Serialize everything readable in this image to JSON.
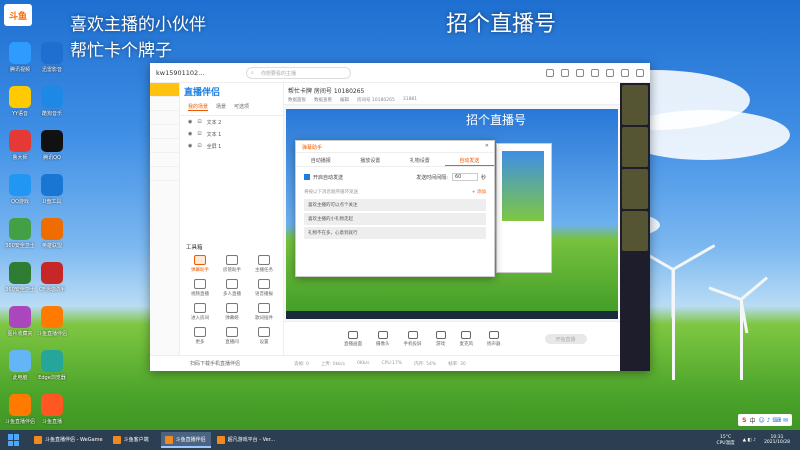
{
  "overlay": {
    "line1": "喜欢主播的小伙伴",
    "line2": "帮忙卡个牌子",
    "stream_title": "招个直播号",
    "douyu_logo": "斗鱼"
  },
  "desktop_icons": [
    {
      "label": "腾讯视频",
      "icon": "video-icon",
      "color": "#2f9bff"
    },
    {
      "label": "迅雷影音",
      "icon": "player-icon",
      "color": "#1e6fd0"
    },
    {
      "label": "YY语音",
      "icon": "yy-icon",
      "color": "#ffcb00"
    },
    {
      "label": "酷狗音乐",
      "icon": "kugou-icon",
      "color": "#1e88e5"
    },
    {
      "label": "鲁大师",
      "icon": "ludashi-icon",
      "color": "#e53935"
    },
    {
      "label": "腾讯QQ",
      "icon": "qq-icon",
      "color": "#111111"
    },
    {
      "label": "QQ游戏",
      "icon": "qqgame-icon",
      "color": "#2196f3"
    },
    {
      "label": "U盘工具",
      "icon": "usb-icon",
      "color": "#1976d2"
    },
    {
      "label": "360安全卫士",
      "icon": "shield-icon",
      "color": "#43a047"
    },
    {
      "label": "英雄联盟",
      "icon": "game-icon",
      "color": "#ef6c00"
    },
    {
      "label": "360安全卫士",
      "icon": "plus-icon",
      "color": "#2e7d32"
    },
    {
      "label": "CF活动助手",
      "icon": "cf-icon",
      "color": "#c62828"
    },
    {
      "label": "图片收藏夹",
      "icon": "photo-icon",
      "color": "#ab47bc"
    },
    {
      "label": "斗鱼直播伴侣",
      "icon": "douyu-icon",
      "color": "#ff7a00"
    },
    {
      "label": "此电脑",
      "icon": "computer-icon",
      "color": "#64b5f6"
    },
    {
      "label": "Edge浏览器",
      "icon": "browser-icon",
      "color": "#26a69a"
    },
    {
      "label": "斗鱼直播伴侣",
      "icon": "douyu-icon",
      "color": "#ff7a00"
    },
    {
      "label": "斗鱼直播",
      "icon": "douyu-icon",
      "color": "#ff5722"
    }
  ],
  "window": {
    "account": "kw15901102...",
    "search_placeholder": "你想要看的主播",
    "logo": "直播伴侣",
    "panel_tabs": [
      "我的场景",
      "场景",
      "可选项"
    ],
    "scenes": [
      "文本 2",
      "文本 1",
      "全屏 1"
    ],
    "tools_title": "工具箱",
    "tools": [
      {
        "label": "弹幕助手",
        "active": true
      },
      {
        "label": "房管助手",
        "active": false
      },
      {
        "label": "主播任务",
        "active": false
      },
      {
        "label": "视频直播",
        "active": false
      },
      {
        "label": "多人直播",
        "active": false
      },
      {
        "label": "语音播报",
        "active": false
      },
      {
        "label": "进入房间",
        "active": false
      },
      {
        "label": "弹幕姬",
        "active": false
      },
      {
        "label": "歌词插件",
        "active": false
      },
      {
        "label": "更多",
        "active": false
      },
      {
        "label": "直播间",
        "active": false
      },
      {
        "label": "设置",
        "active": false
      }
    ],
    "room_title": "帮忙卡牌 房间号 10180265",
    "room_meta": [
      "数据面板",
      "数据查看",
      "编辑",
      "房间号 10180265",
      "31881"
    ],
    "preview_title": "招个直播号",
    "controls": [
      "直播画面",
      "摄像头",
      "手机投屏",
      "游戏",
      "麦克风",
      "扬声器"
    ],
    "start_button": "开始直播",
    "status": [
      "丢帧: 0",
      "上传: 0kb/s",
      "0Kb/s",
      "CPU:17%",
      "内存: 54%",
      "帧率: 30"
    ],
    "bottom_hint": "扫码下载手机直播伴侣"
  },
  "dialog": {
    "title": "弹幕助手",
    "tabs": [
      "自动播报",
      "播放设置",
      "礼物设置",
      "自动发送"
    ],
    "active_tab": 3,
    "auto_send_label": "开启自动发送",
    "interval_label": "发送时间间隔:",
    "interval_value": "60",
    "interval_unit": "秒",
    "hint": "将按以下消息顺序循环发送",
    "add_label": "+ 添加",
    "messages": [
      "喜欢主播的可以点个关注",
      "喜欢主播的小礼物走起",
      "礼物不在多，心意到就行"
    ]
  },
  "taskbar": {
    "items": [
      {
        "label": "斗鱼直播伴侣 - WeGame",
        "active": false
      },
      {
        "label": "斗鱼客户端",
        "active": false
      },
      {
        "label": "斗鱼直播伴侣",
        "active": true
      },
      {
        "label": "超凡游戏平台 - Ver...",
        "active": false
      }
    ],
    "weather": "15°C",
    "cpu": "CPU温度",
    "time": "10:31",
    "date": "2021/10/28",
    "ime": "中"
  }
}
